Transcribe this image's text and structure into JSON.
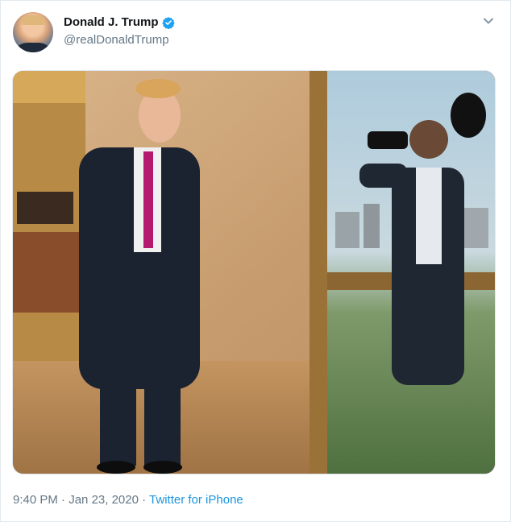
{
  "author": {
    "display_name": "Donald J. Trump",
    "handle": "@realDonaldTrump",
    "verified": true
  },
  "icons": {
    "verified": "verified-badge-icon",
    "menu": "chevron-down-icon"
  },
  "colors": {
    "link": "#1b95e0",
    "verified": "#1da1f2",
    "secondary_text": "#657786",
    "primary_text": "#14171a"
  },
  "footer": {
    "time": "9:40 PM",
    "separator1": " · ",
    "date": "Jan 23, 2020",
    "separator2": " · ",
    "source": "Twitter for iPhone"
  }
}
